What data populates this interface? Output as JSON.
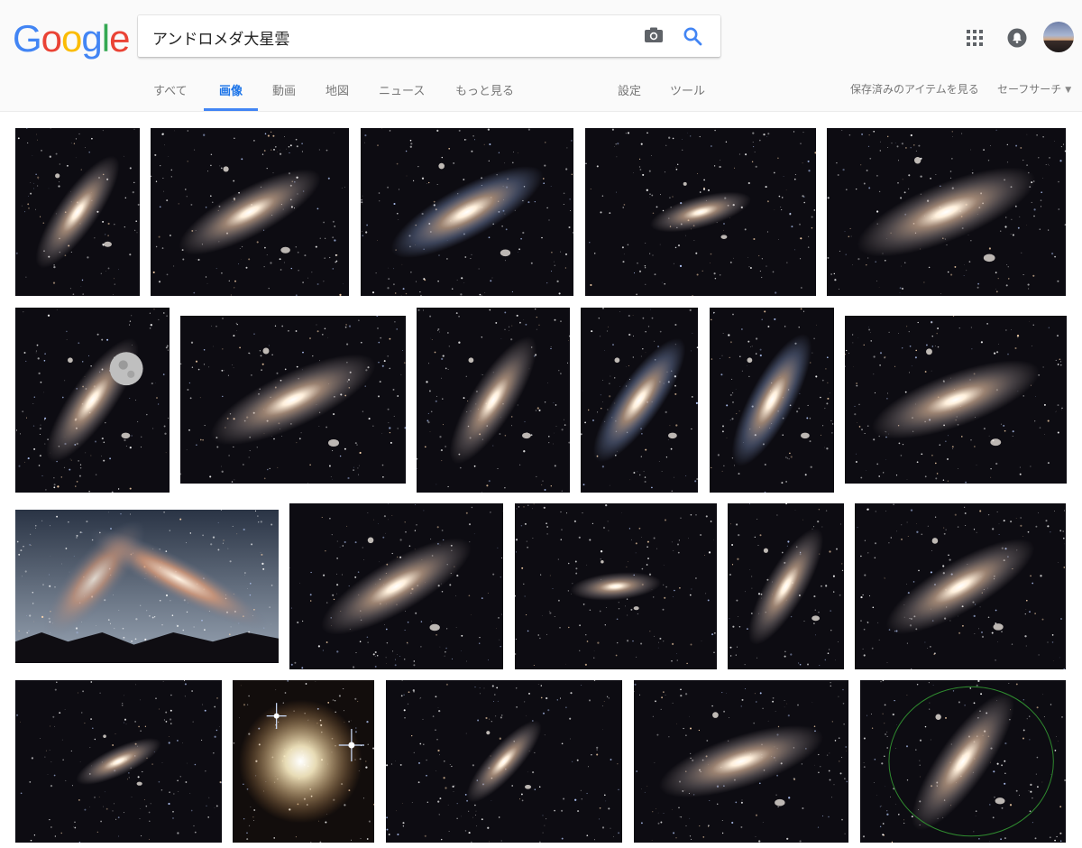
{
  "logo": {
    "letters": [
      "G",
      "o",
      "o",
      "g",
      "l",
      "e"
    ],
    "colors": [
      "#4285F4",
      "#EA4335",
      "#FBBC05",
      "#4285F4",
      "#34A853",
      "#EA4335"
    ]
  },
  "search": {
    "query": "アンドロメダ大星雲"
  },
  "tabs": [
    {
      "label": "すべて"
    },
    {
      "label": "画像"
    },
    {
      "label": "動画"
    },
    {
      "label": "地図"
    },
    {
      "label": "ニュース"
    },
    {
      "label": "もっと見る"
    },
    {
      "label": "設定"
    },
    {
      "label": "ツール"
    }
  ],
  "active_tab": "画像",
  "right_links": {
    "saved": "保存済みのアイテムを見る",
    "safesearch": "セーフサーチ"
  },
  "icons": {
    "camera": "camera-icon",
    "search": "search-icon",
    "apps": "apps-grid-icon",
    "notifications": "bell-icon",
    "account": "avatar"
  },
  "accent_color": "#4285f4",
  "results": [
    {
      "kind": "galaxy"
    },
    {
      "kind": "galaxy"
    },
    {
      "kind": "galaxy-blue"
    },
    {
      "kind": "galaxy-small"
    },
    {
      "kind": "galaxy"
    },
    {
      "kind": "galaxy-moon"
    },
    {
      "kind": "galaxy"
    },
    {
      "kind": "galaxy"
    },
    {
      "kind": "galaxy-blue"
    },
    {
      "kind": "galaxy-blue"
    },
    {
      "kind": "galaxy"
    },
    {
      "kind": "milky-way-landscape"
    },
    {
      "kind": "galaxy"
    },
    {
      "kind": "galaxy-small"
    },
    {
      "kind": "galaxy"
    },
    {
      "kind": "galaxy"
    },
    {
      "kind": "galaxy-small"
    },
    {
      "kind": "star-cluster"
    },
    {
      "kind": "galaxy-small"
    },
    {
      "kind": "galaxy"
    },
    {
      "kind": "galaxy-circle"
    }
  ]
}
